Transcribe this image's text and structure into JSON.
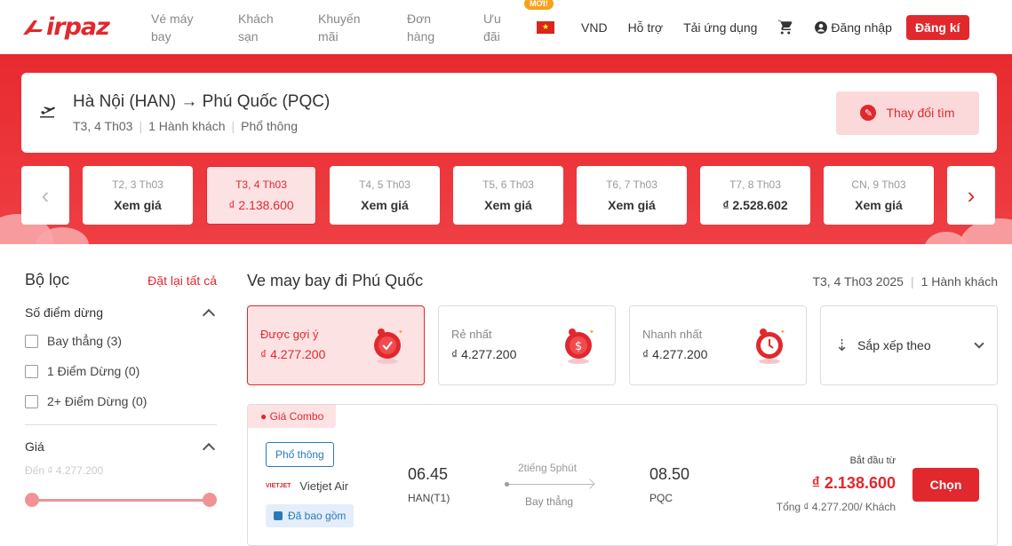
{
  "brand": {
    "logo_text": "irpaz",
    "accent": "#e1282d"
  },
  "nav": [
    {
      "label": "Vé máy bay"
    },
    {
      "label": "Khách sạn"
    },
    {
      "label": "Khuyến mãi"
    },
    {
      "label": "Đơn hàng"
    },
    {
      "label": "Ưu đãi"
    }
  ],
  "header": {
    "new_badge": "MỚI!",
    "currency": "VND",
    "support": "Hỗ trợ",
    "app": "Tải ứng dụng",
    "login": "Đăng nhập",
    "signup": "Đăng kí"
  },
  "search": {
    "route": "Hà Nội (HAN) → Phú Quốc (PQC)",
    "date": "T3, 4 Th03",
    "pax": "1 Hành khách",
    "cabin": "Phổ thông",
    "change": "Thay đổi tìm"
  },
  "dates": [
    {
      "day": "T2, 3 Th03",
      "price": "Xem giá"
    },
    {
      "day": "T3, 4 Th03",
      "price": "₫ 2.138.600",
      "active": true
    },
    {
      "day": "T4, 5 Th03",
      "price": "Xem giá"
    },
    {
      "day": "T5, 6 Th03",
      "price": "Xem giá"
    },
    {
      "day": "T6, 7 Th03",
      "price": "Xem giá"
    },
    {
      "day": "T7, 8 Th03",
      "price": "₫ 2.528.602"
    },
    {
      "day": "CN, 9 Th03",
      "price": "Xem giá"
    }
  ],
  "filter": {
    "title": "Bộ lọc",
    "reset": "Đặt lại tất cả",
    "stops_title": "Số điểm dừng",
    "stops": [
      {
        "label": "Bay thẳng (3)"
      },
      {
        "label": "1 Điểm Dừng (0)"
      },
      {
        "label": "2+ Điểm Dừng (0)"
      }
    ],
    "price_title": "Giá",
    "price_label": "Đến ₫ 4.277.200"
  },
  "main": {
    "title": "Ve may bay đi Phú Quốc",
    "date": "T3, 4 Th03 2025",
    "pax": "1 Hành khách"
  },
  "sort": {
    "cards": [
      {
        "label": "Được gợi ý",
        "value": "₫ 4.277.200"
      },
      {
        "label": "Rẻ nhất",
        "value": "₫ 4.277.200"
      },
      {
        "label": "Nhanh nhất",
        "value": "₫ 4.277.200"
      }
    ],
    "dropdown": "Sắp xếp theo"
  },
  "flight": {
    "combo": "● Giá Combo",
    "cabin": "Phổ thông",
    "airline_logo": "VIETJET",
    "airline": "Vietjet Air",
    "included": "Đã bao gồm",
    "dep_time": "06.45",
    "dep_code": "HAN(T1)",
    "duration": "2tiếng 5phút",
    "direct": "Bay thẳng",
    "arr_time": "08.50",
    "arr_code": "PQC",
    "from": "Bắt đầu từ",
    "price": "₫ 2.138.600",
    "total": "Tổng ₫ 4.277.200/ Khách",
    "choose": "Chọn"
  }
}
